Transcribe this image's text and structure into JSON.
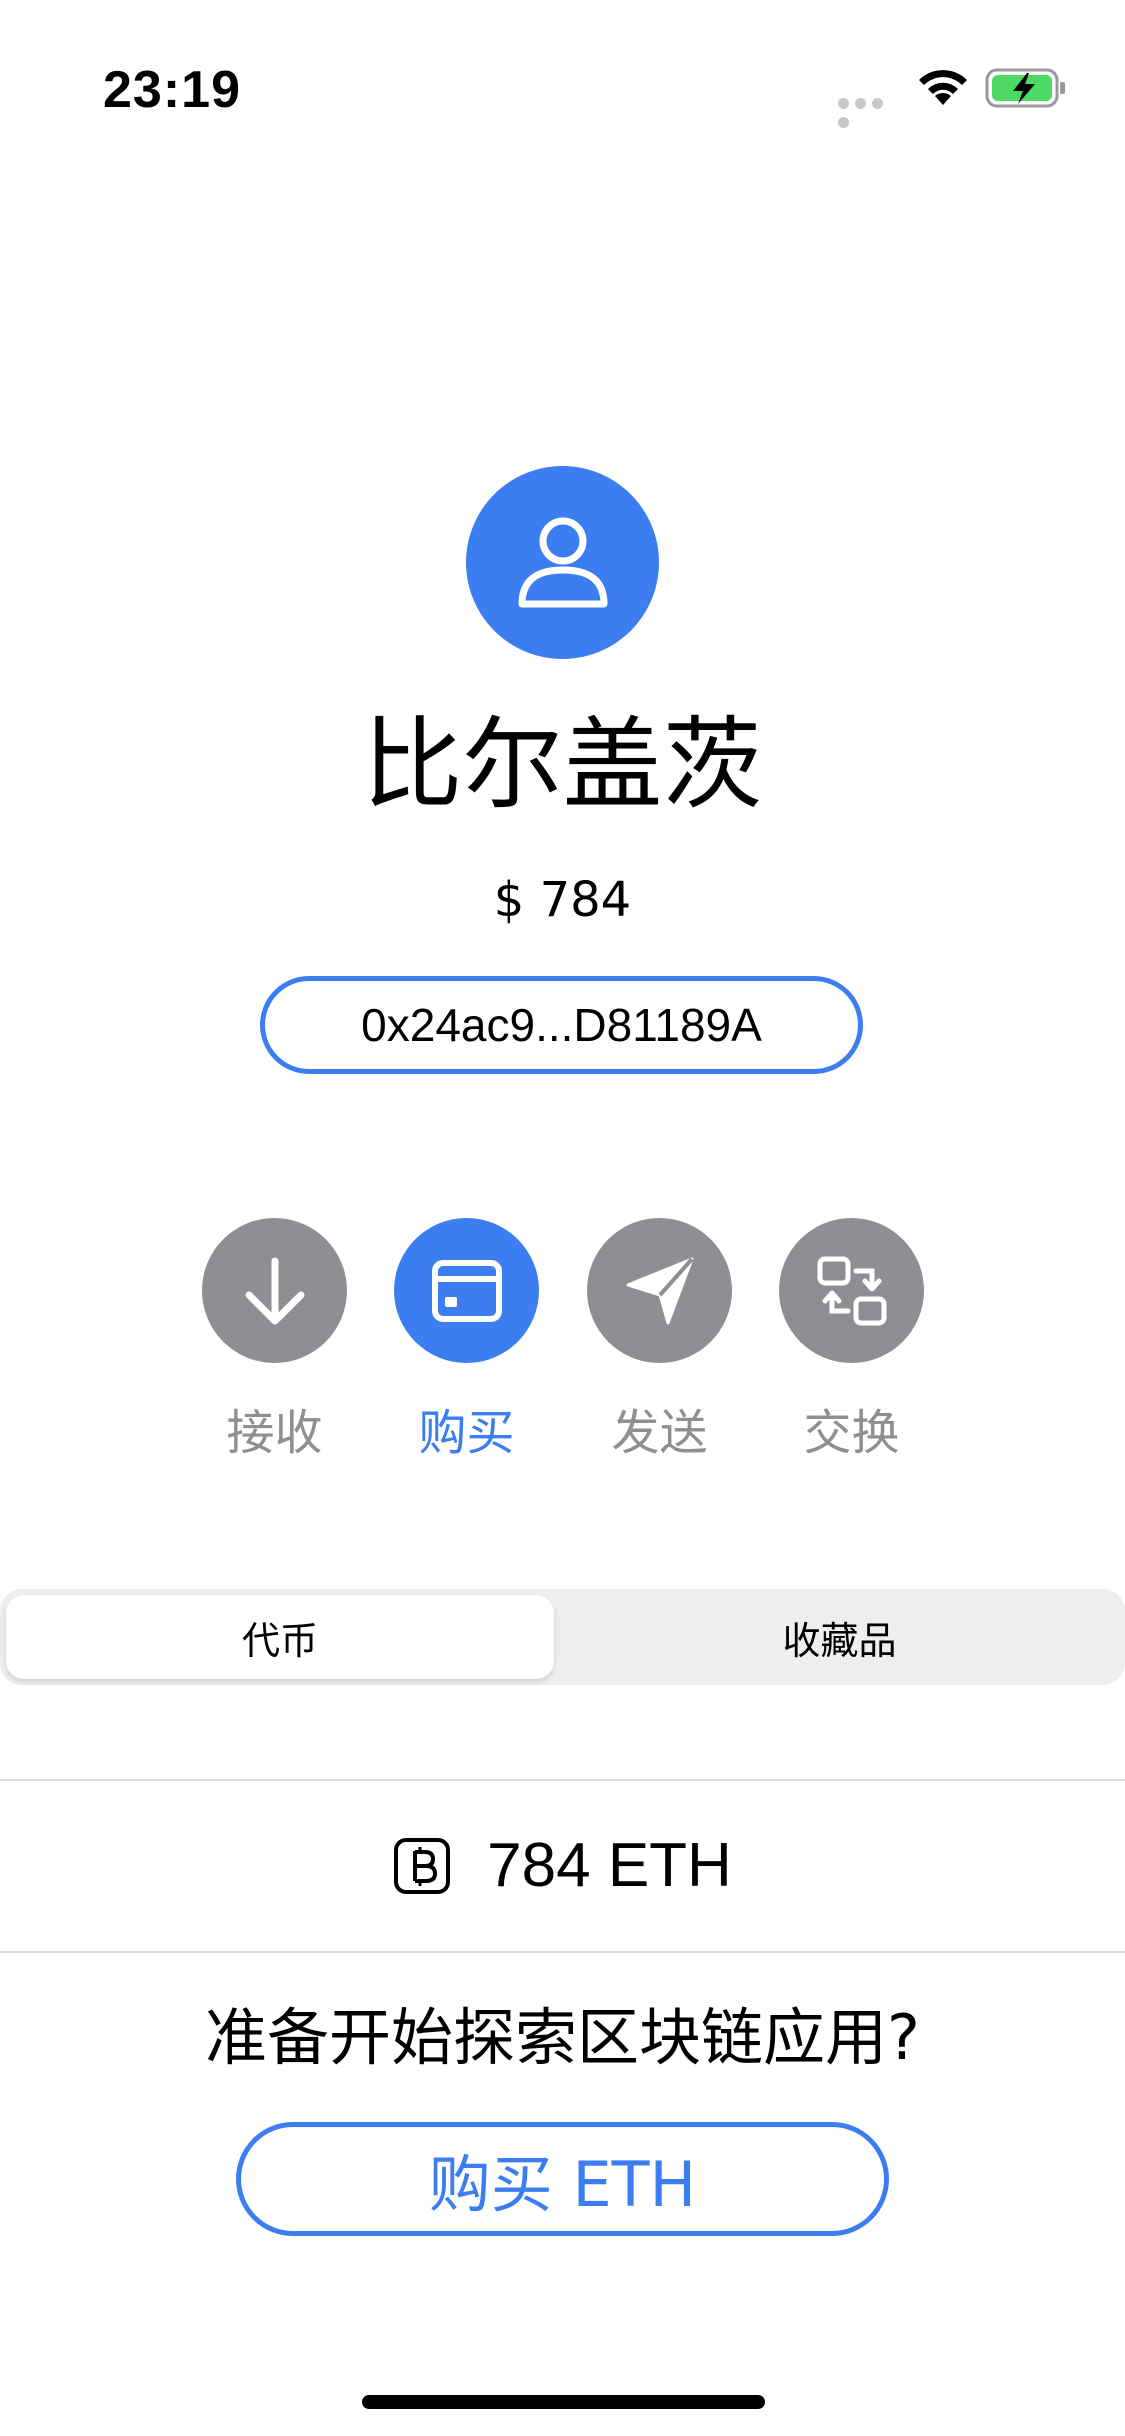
{
  "status_bar": {
    "time": "23:19"
  },
  "account": {
    "name": "比尔盖茨",
    "balance_usd": "$ 784",
    "address": "0x24ac9...D81189A"
  },
  "actions": [
    {
      "label": "接收",
      "icon": "arrow-down-icon",
      "active": false
    },
    {
      "label": "购买",
      "icon": "card-icon",
      "active": true
    },
    {
      "label": "发送",
      "icon": "send-icon",
      "active": false
    },
    {
      "label": "交换",
      "icon": "swap-icon",
      "active": false
    }
  ],
  "tabs": {
    "tokens": "代币",
    "collectibles": "收藏品",
    "selected": "tokens"
  },
  "token": {
    "icon": "bitcoin-icon",
    "amount": "784 ETH"
  },
  "cta": {
    "prompt": "准备开始探索区块链应用?",
    "button_label": "购买 ETH"
  },
  "colors": {
    "accent": "#3c7ef2",
    "inactive": "#8e8e93",
    "battery": "#4cd964"
  }
}
